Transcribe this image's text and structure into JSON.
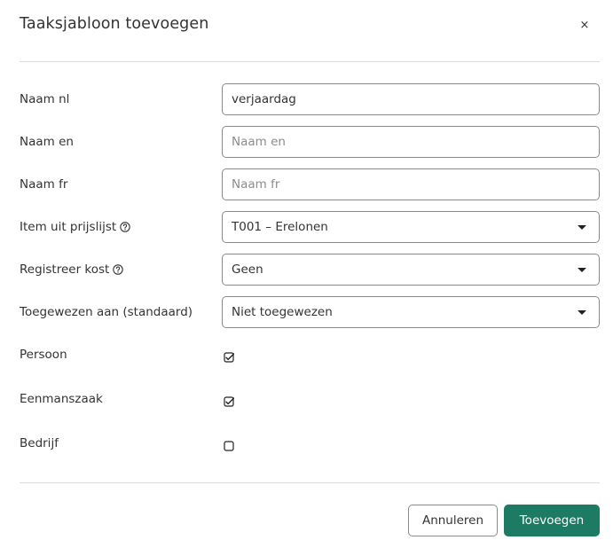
{
  "dialog": {
    "title": "Taaksjabloon toevoegen",
    "close_label": "×"
  },
  "form": {
    "naam_nl": {
      "label": "Naam nl",
      "value": "verjaardag",
      "placeholder": ""
    },
    "naam_en": {
      "label": "Naam en",
      "value": "",
      "placeholder": "Naam en"
    },
    "naam_fr": {
      "label": "Naam fr",
      "value": "",
      "placeholder": "Naam fr"
    },
    "item_prijslijst": {
      "label": "Item uit prijslijst",
      "selected": "T001 – Erelonen",
      "has_help": true
    },
    "registreer_kost": {
      "label": "Registreer kost",
      "selected": "Geen",
      "has_help": true
    },
    "toegewezen_aan": {
      "label": "Toegewezen aan (standaard)",
      "selected": "Niet toegewezen"
    },
    "persoon": {
      "label": "Persoon",
      "checked": true
    },
    "eenmanszaak": {
      "label": "Eenmanszaak",
      "checked": true
    },
    "bedrijf": {
      "label": "Bedrijf",
      "checked": false
    }
  },
  "footer": {
    "cancel_label": "Annuleren",
    "submit_label": "Toevoegen"
  },
  "colors": {
    "primary": "#1d7a63",
    "border": "#8a8a8a",
    "divider": "#dcdcdc"
  }
}
